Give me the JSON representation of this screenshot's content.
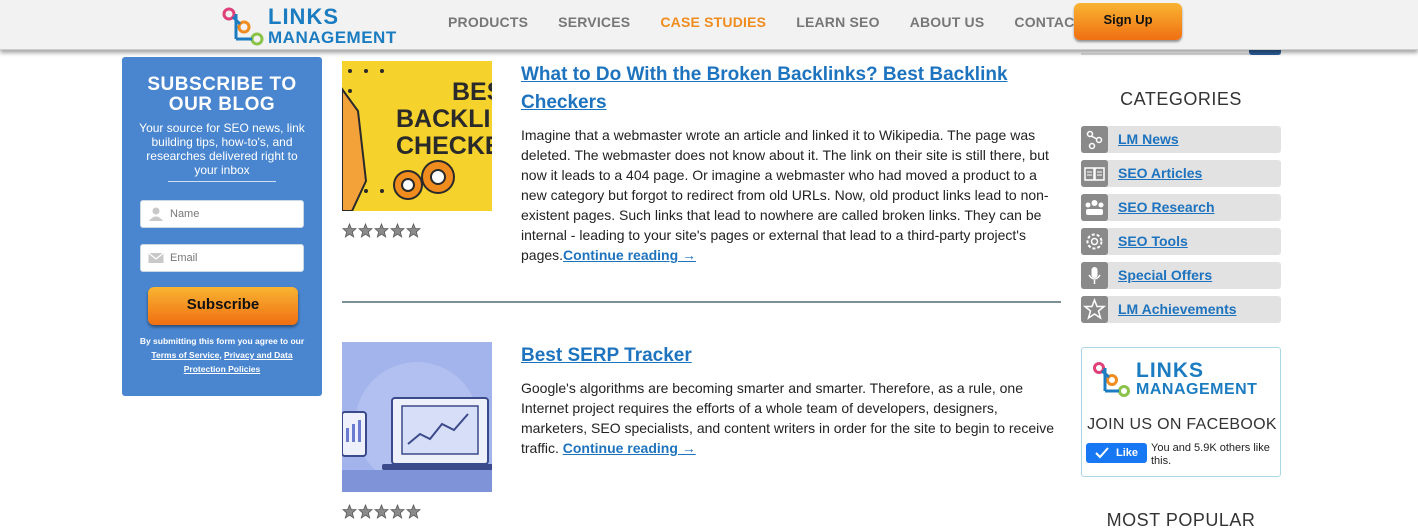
{
  "header": {
    "logo": {
      "line1": "LINKS",
      "line2": "MANAGEMENT"
    },
    "nav": [
      {
        "label": "PRODUCTS"
      },
      {
        "label": "SERVICES"
      },
      {
        "label": "CASE STUDIES",
        "active": true
      },
      {
        "label": "LEARN SEO"
      },
      {
        "label": "ABOUT US"
      },
      {
        "label": "CONTACT US"
      }
    ],
    "signup_label": "Sign Up"
  },
  "subscribe": {
    "title_line1": "SUBSCRIBE TO",
    "title_line2": "OUR BLOG",
    "description": "Your source for SEO news, link building tips, how-to's, and researches delivered right to your inbox",
    "name_placeholder": "Name",
    "email_placeholder": "Email",
    "button_label": "Subscribe",
    "note_prefix": "By submitting this form you agree to our ",
    "terms_link": "Terms of Service",
    "note_comma": ", ",
    "privacy_link": "Privacy and Data Protection Policies"
  },
  "posts": [
    {
      "image_text": [
        "BEST",
        "BACKLI",
        "CHECKE"
      ],
      "title": "What to Do With the Broken Backlinks? Best Backlink Checkers",
      "excerpt": "Imagine that a webmaster wrote an article and linked it to Wikipedia. The page was deleted. The webmaster does not know about it. The link on their site is still there, but now it leads to a 404 page. Or imagine a webmaster who had moved a product to a new category but forgot to redirect from old URLs. Now, old product links lead to non-existent pages. Such links that lead to nowhere are called broken links. They can be internal - leading to your site's pages or external that lead to a third-party project's pages.",
      "read_more": "Continue reading →",
      "rating": 0
    },
    {
      "title": "Best SERP Tracker",
      "excerpt": "Google's algorithms are becoming smarter and smarter. Therefore, as a rule, one Internet project requires the efforts of a whole team of developers, designers, marketers, SEO specialists, and content writers in order for the site to begin to receive traffic. ",
      "read_more": "Continue reading →",
      "rating": 0
    }
  ],
  "sidebar": {
    "categories_title": "CATEGORIES",
    "categories": [
      {
        "label": "LM News",
        "icon": "branch-icon"
      },
      {
        "label": "SEO Articles",
        "icon": "book-icon"
      },
      {
        "label": "SEO Research",
        "icon": "team-icon"
      },
      {
        "label": "SEO Tools",
        "icon": "gear-icon"
      },
      {
        "label": "Special Offers",
        "icon": "microphone-icon"
      },
      {
        "label": "LM Achievements",
        "icon": "star-icon"
      }
    ],
    "facebook": {
      "logo_line1": "LINKS",
      "logo_line2": "MANAGEMENT",
      "join": "JOIN US ON FACEBOOK",
      "like_label": "Like",
      "like_count": "You and 5.9K others like this."
    },
    "most_popular": "MOST POPULAR"
  },
  "colors": {
    "brand_blue": "#1b7cc1",
    "link_blue": "#1e73be",
    "accent_orange": "#f08c1e",
    "subscribe_bg": "#4a86d0"
  }
}
